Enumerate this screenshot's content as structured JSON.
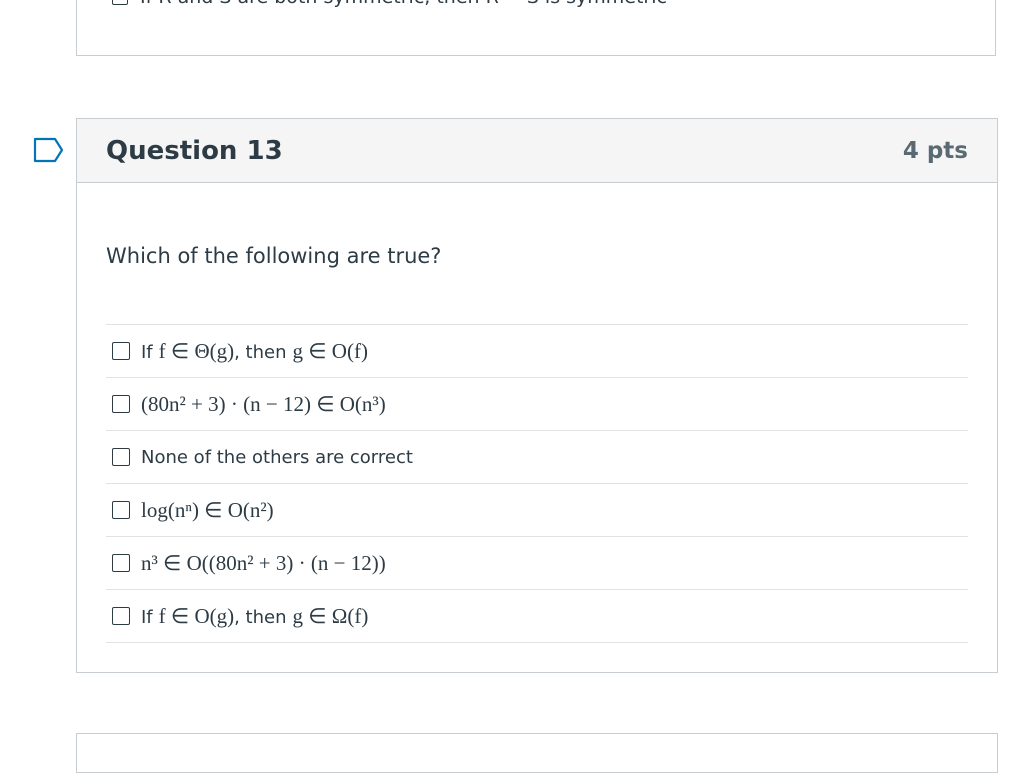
{
  "previous_question": {
    "answer_text": "If R and S are both symmetric, then R − S is symmetric"
  },
  "question": {
    "title": "Question 13",
    "points": "4 pts",
    "prompt": "Which of the following are true?",
    "answers": [
      {
        "prefix": "If",
        "math": "f ∈ Θ(g)",
        "mid": ", then",
        "math2": "g ∈ O(f)"
      },
      {
        "math": "(80n² + 3) · (n − 12) ∈ O(n³)"
      },
      {
        "text": "None of the others are correct"
      },
      {
        "math": "log(nⁿ) ∈ O(n²)"
      },
      {
        "math": "n³ ∈ O((80n² + 3) · (n − 12))"
      },
      {
        "prefix": "If",
        "math": "f ∈ O(g)",
        "mid": ", then",
        "math2": "g ∈ Ω(f)"
      }
    ]
  },
  "icons": {
    "flag": "flag-icon"
  },
  "colors": {
    "text": "#2d3b45",
    "header_bg": "#f5f5f5",
    "border": "#c7cdd1",
    "points": "#5a6a75"
  }
}
